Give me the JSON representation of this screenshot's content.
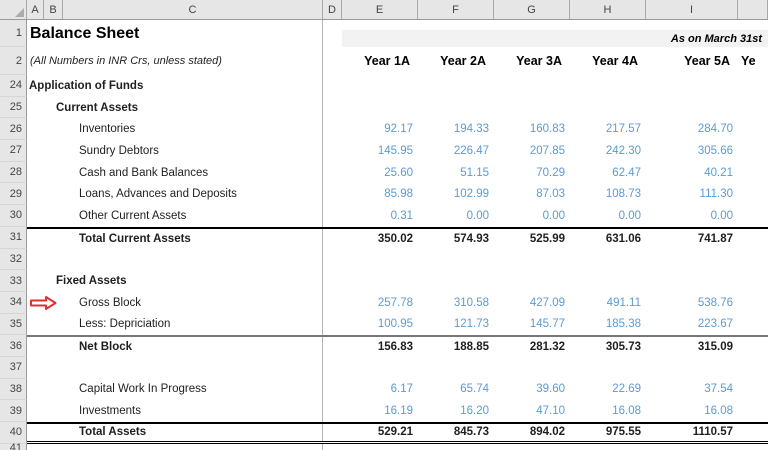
{
  "colors": {
    "value_blue": "#5B9BD5",
    "arrow_red": "#E03131",
    "band_bg": "#F2F2F2",
    "header_bg": "#E6E6E6",
    "grid_line": "#B3B3B3"
  },
  "column_headers": [
    "A",
    "B",
    "C",
    "D",
    "E",
    "F",
    "G",
    "H",
    "I",
    ""
  ],
  "title_row": {
    "row_num": "1",
    "title": "Balance Sheet",
    "as_on": "As on March 31st"
  },
  "subtitle_row": {
    "row_num": "2",
    "subtitle": "(All Numbers in INR Crs, unless stated)",
    "year_headers": [
      "Year 1A",
      "Year 2A",
      "Year 3A",
      "Year 4A",
      "Year 5A"
    ],
    "partial_header": "Ye"
  },
  "rows": [
    {
      "num": "24",
      "label": "Application of Funds",
      "bold": true,
      "indent": 0,
      "values": []
    },
    {
      "num": "25",
      "label": "Current Assets",
      "bold": true,
      "indent": 1,
      "values": []
    },
    {
      "num": "26",
      "label": "Inventories",
      "indent": 2,
      "blue": true,
      "values": [
        "92.17",
        "194.33",
        "160.83",
        "217.57",
        "284.70"
      ]
    },
    {
      "num": "27",
      "label": "Sundry Debtors",
      "indent": 2,
      "blue": true,
      "values": [
        "145.95",
        "226.47",
        "207.85",
        "242.30",
        "305.66"
      ]
    },
    {
      "num": "28",
      "label": "Cash and Bank Balances",
      "indent": 2,
      "blue": true,
      "values": [
        "25.60",
        "51.15",
        "70.29",
        "62.47",
        "40.21"
      ]
    },
    {
      "num": "29",
      "label": "Loans, Advances and Deposits",
      "indent": 2,
      "blue": true,
      "values": [
        "85.98",
        "102.99",
        "87.03",
        "108.73",
        "111.30"
      ]
    },
    {
      "num": "30",
      "label": "Other Current Assets",
      "indent": 2,
      "blue": true,
      "values": [
        "0.31",
        "0.00",
        "0.00",
        "0.00",
        "0.00"
      ]
    },
    {
      "num": "31",
      "label": "Total Current Assets",
      "bold": true,
      "indent": 2,
      "border_top": "black",
      "values": [
        "350.02",
        "574.93",
        "525.99",
        "631.06",
        "741.87"
      ]
    },
    {
      "num": "32",
      "label": "",
      "values": []
    },
    {
      "num": "33",
      "label": "Fixed Assets",
      "bold": true,
      "indent": 1,
      "values": []
    },
    {
      "num": "34",
      "label": "Gross Block",
      "indent": 2,
      "blue": true,
      "arrow": true,
      "values": [
        "257.78",
        "310.58",
        "427.09",
        "491.11",
        "538.76"
      ]
    },
    {
      "num": "35",
      "label": "Less: Depriciation",
      "indent": 2,
      "blue": true,
      "values": [
        "100.95",
        "121.73",
        "145.77",
        "185.38",
        "223.67"
      ]
    },
    {
      "num": "36",
      "label": "Net Block",
      "bold": true,
      "indent": 2,
      "border_top": "gray",
      "values": [
        "156.83",
        "188.85",
        "281.32",
        "305.73",
        "315.09"
      ]
    },
    {
      "num": "37",
      "label": "",
      "values": []
    },
    {
      "num": "38",
      "label": "Capital Work In Progress",
      "indent": 2,
      "blue": true,
      "values": [
        "6.17",
        "65.74",
        "39.60",
        "22.69",
        "37.54"
      ]
    },
    {
      "num": "39",
      "label": "Investments",
      "indent": 2,
      "blue": true,
      "values": [
        "16.19",
        "16.20",
        "47.10",
        "16.08",
        "16.08"
      ]
    },
    {
      "num": "40",
      "label": "Total Assets",
      "bold": true,
      "indent": 2,
      "border_top": "black",
      "double_bottom": true,
      "values": [
        "529.21",
        "845.73",
        "894.02",
        "975.55",
        "1110.57"
      ]
    },
    {
      "num": "41",
      "label": "",
      "partial": true,
      "values": []
    }
  ]
}
